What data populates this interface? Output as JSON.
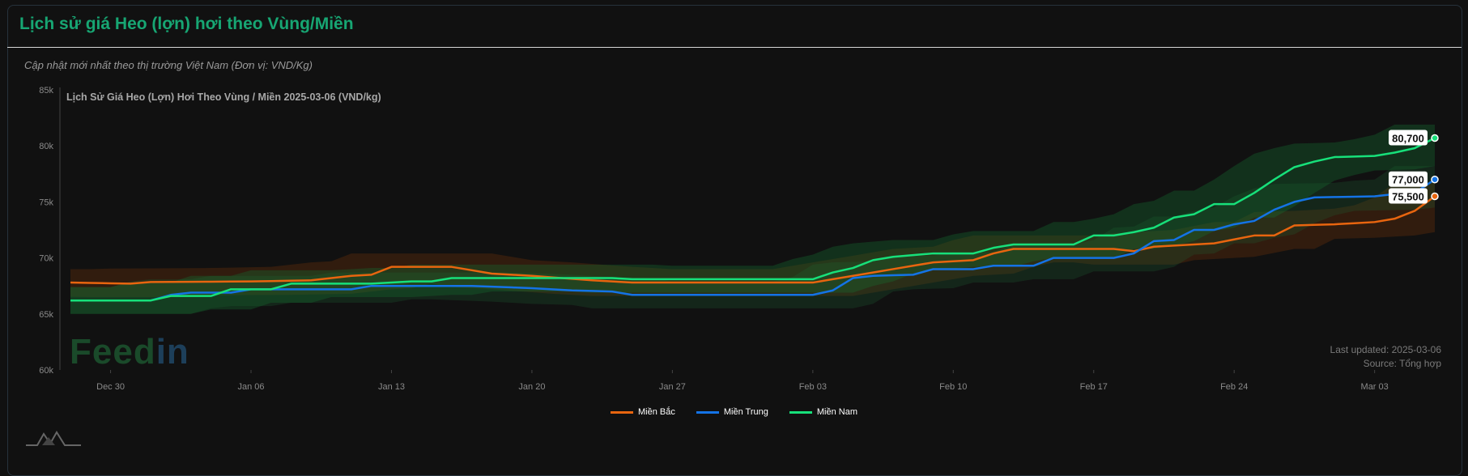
{
  "header": {
    "title": "Lịch sử giá Heo (lợn) hơi theo Vùng/Miền",
    "subtitle": "Cập nhật mới nhất theo thị trường Việt Nam (Đơn vị: VND/Kg)"
  },
  "footer": {
    "last_updated": "Last updated: 2025-03-06",
    "source": "Source: Tổng hợp",
    "logo_text": "Feedin"
  },
  "chart_data": {
    "type": "line",
    "title": "Lịch Sử Giá Heo (Lợn) Hơi Theo Vùng / Miền 2025-03-06 (VND/kg)",
    "xlabel": "",
    "ylabel": "",
    "x_range": [
      "2024-12-28",
      "2025-03-06"
    ],
    "ylim": [
      60000,
      85000
    ],
    "yticks": [
      60000,
      65000,
      70000,
      75000,
      80000,
      85000
    ],
    "ytick_labels": [
      "60k",
      "65k",
      "70k",
      "75k",
      "80k",
      "85k"
    ],
    "xticks": [
      "2024-12-30",
      "2025-01-06",
      "2025-01-13",
      "2025-01-20",
      "2025-01-27",
      "2025-02-03",
      "2025-02-10",
      "2025-02-17",
      "2025-02-24",
      "2025-03-03"
    ],
    "xtick_labels": [
      "Dec 30",
      "Jan 06",
      "Jan 13",
      "Jan 20",
      "Jan 27",
      "Feb 03",
      "Feb 10",
      "Feb 17",
      "Feb 24",
      "Mar 03"
    ],
    "grid": false,
    "legend_position": "bottom-center",
    "series": [
      {
        "name": "Miền Bắc",
        "color": "#e8650f",
        "last_label": "75,500",
        "points": [
          [
            "2024-12-28",
            67800
          ],
          [
            "2024-12-31",
            67700
          ],
          [
            "2025-01-01",
            67850
          ],
          [
            "2025-01-06",
            67900
          ],
          [
            "2025-01-09",
            68000
          ],
          [
            "2025-01-10",
            68200
          ],
          [
            "2025-01-11",
            68400
          ],
          [
            "2025-01-12",
            68500
          ],
          [
            "2025-01-13",
            69200
          ],
          [
            "2025-01-16",
            69200
          ],
          [
            "2025-01-17",
            68900
          ],
          [
            "2025-01-18",
            68600
          ],
          [
            "2025-01-20",
            68400
          ],
          [
            "2025-01-23",
            68000
          ],
          [
            "2025-01-25",
            67800
          ],
          [
            "2025-02-03",
            67800
          ],
          [
            "2025-02-05",
            68400
          ],
          [
            "2025-02-07",
            69000
          ],
          [
            "2025-02-09",
            69600
          ],
          [
            "2025-02-11",
            69800
          ],
          [
            "2025-02-12",
            70400
          ],
          [
            "2025-02-13",
            70800
          ],
          [
            "2025-02-18",
            70800
          ],
          [
            "2025-02-19",
            70600
          ],
          [
            "2025-02-20",
            71000
          ],
          [
            "2025-02-23",
            71300
          ],
          [
            "2025-02-25",
            72000
          ],
          [
            "2025-02-26",
            72000
          ],
          [
            "2025-02-27",
            72900
          ],
          [
            "2025-03-01",
            73000
          ],
          [
            "2025-03-03",
            73200
          ],
          [
            "2025-03-04",
            73500
          ],
          [
            "2025-03-05",
            74200
          ],
          [
            "2025-03-06",
            75500
          ]
        ]
      },
      {
        "name": "Miền Trung",
        "color": "#1473e6",
        "last_label": "77,000",
        "points": [
          [
            "2024-12-28",
            66200
          ],
          [
            "2025-01-01",
            66200
          ],
          [
            "2025-01-02",
            66700
          ],
          [
            "2025-01-03",
            66900
          ],
          [
            "2025-01-05",
            66900
          ],
          [
            "2025-01-06",
            67200
          ],
          [
            "2025-01-11",
            67200
          ],
          [
            "2025-01-12",
            67500
          ],
          [
            "2025-01-17",
            67500
          ],
          [
            "2025-01-20",
            67300
          ],
          [
            "2025-01-22",
            67100
          ],
          [
            "2025-01-24",
            67000
          ],
          [
            "2025-01-25",
            66700
          ],
          [
            "2025-02-03",
            66700
          ],
          [
            "2025-02-04",
            67100
          ],
          [
            "2025-02-05",
            68200
          ],
          [
            "2025-02-06",
            68400
          ],
          [
            "2025-02-08",
            68500
          ],
          [
            "2025-02-09",
            69000
          ],
          [
            "2025-02-11",
            69000
          ],
          [
            "2025-02-12",
            69300
          ],
          [
            "2025-02-14",
            69300
          ],
          [
            "2025-02-15",
            70000
          ],
          [
            "2025-02-18",
            70000
          ],
          [
            "2025-02-19",
            70400
          ],
          [
            "2025-02-20",
            71500
          ],
          [
            "2025-02-21",
            71600
          ],
          [
            "2025-02-22",
            72500
          ],
          [
            "2025-02-23",
            72500
          ],
          [
            "2025-02-24",
            73000
          ],
          [
            "2025-02-25",
            73300
          ],
          [
            "2025-02-26",
            74300
          ],
          [
            "2025-02-27",
            75000
          ],
          [
            "2025-02-28",
            75400
          ],
          [
            "2025-03-03",
            75500
          ],
          [
            "2025-03-04",
            75700
          ],
          [
            "2025-03-05",
            75800
          ],
          [
            "2025-03-06",
            77000
          ]
        ]
      },
      {
        "name": "Miền Nam",
        "color": "#17e07a",
        "last_label": "80,700",
        "points": [
          [
            "2024-12-28",
            66200
          ],
          [
            "2025-01-01",
            66200
          ],
          [
            "2025-01-02",
            66600
          ],
          [
            "2025-01-04",
            66600
          ],
          [
            "2025-01-05",
            67200
          ],
          [
            "2025-01-07",
            67200
          ],
          [
            "2025-01-08",
            67700
          ],
          [
            "2025-01-12",
            67700
          ],
          [
            "2025-01-14",
            67900
          ],
          [
            "2025-01-15",
            67900
          ],
          [
            "2025-01-16",
            68200
          ],
          [
            "2025-01-24",
            68200
          ],
          [
            "2025-01-25",
            68100
          ],
          [
            "2025-02-03",
            68100
          ],
          [
            "2025-02-04",
            68700
          ],
          [
            "2025-02-05",
            69100
          ],
          [
            "2025-02-06",
            69800
          ],
          [
            "2025-02-07",
            70100
          ],
          [
            "2025-02-09",
            70400
          ],
          [
            "2025-02-11",
            70400
          ],
          [
            "2025-02-12",
            70900
          ],
          [
            "2025-02-13",
            71200
          ],
          [
            "2025-02-16",
            71200
          ],
          [
            "2025-02-17",
            72000
          ],
          [
            "2025-02-18",
            72000
          ],
          [
            "2025-02-19",
            72300
          ],
          [
            "2025-02-20",
            72700
          ],
          [
            "2025-02-21",
            73600
          ],
          [
            "2025-02-22",
            73900
          ],
          [
            "2025-02-23",
            74800
          ],
          [
            "2025-02-24",
            74800
          ],
          [
            "2025-02-25",
            75800
          ],
          [
            "2025-02-26",
            77000
          ],
          [
            "2025-02-27",
            78100
          ],
          [
            "2025-02-28",
            78600
          ],
          [
            "2025-03-01",
            79000
          ],
          [
            "2025-03-03",
            79100
          ],
          [
            "2025-03-04",
            79400
          ],
          [
            "2025-03-05",
            79800
          ],
          [
            "2025-03-06",
            80700
          ]
        ]
      }
    ]
  }
}
